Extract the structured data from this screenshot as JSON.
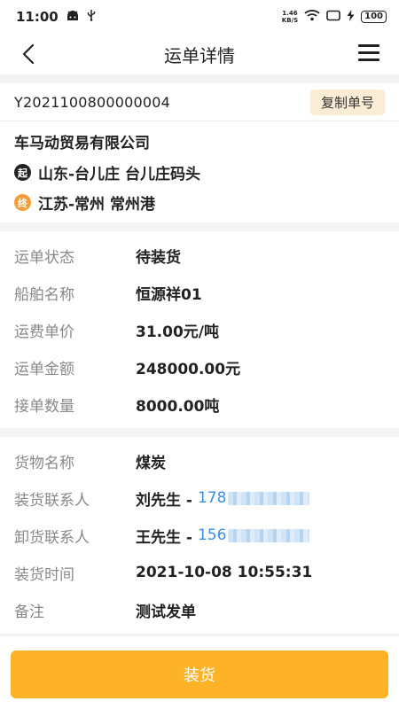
{
  "status_bar": {
    "time": "11:00",
    "speed_value": "1.46",
    "speed_unit": "KB/S",
    "battery": "100"
  },
  "nav": {
    "title": "运单详情"
  },
  "order": {
    "number": "Y2021100800000004",
    "copy_label": "复制单号"
  },
  "company": "车马动贸易有限公司",
  "route": {
    "start_badge": "起",
    "start": "山东-台儿庄 台儿庄码头",
    "end_badge": "终",
    "end": "江苏-常州 常州港"
  },
  "waybill": {
    "status_label": "运单状态",
    "status_value": "待装货",
    "ship_label": "船舶名称",
    "ship_value": "恒源祥01",
    "unit_price_label": "运费单价",
    "unit_price_value": "31.00元/吨",
    "amount_label": "运单金额",
    "amount_value": "248000.00元",
    "quantity_label": "接单数量",
    "quantity_value": "8000.00吨"
  },
  "cargo": {
    "name_label": "货物名称",
    "name_value": "煤炭",
    "loading_contact_label": "装货联系人",
    "loading_contact_name": "刘先生 -",
    "loading_contact_phone": "178",
    "unloading_contact_label": "卸货联系人",
    "unloading_contact_name": "王先生 -",
    "unloading_contact_phone": "156",
    "loading_time_label": "装货时间",
    "loading_time_value": "2021-10-08 10:55:31",
    "remark_label": "备注",
    "remark_value": "测试发单"
  },
  "action": {
    "load_label": "装货"
  },
  "colors": {
    "accent": "#fdb228",
    "phone": "#3a8ee6",
    "end_badge": "#f29d38",
    "copy_bg": "#fbecd6"
  }
}
